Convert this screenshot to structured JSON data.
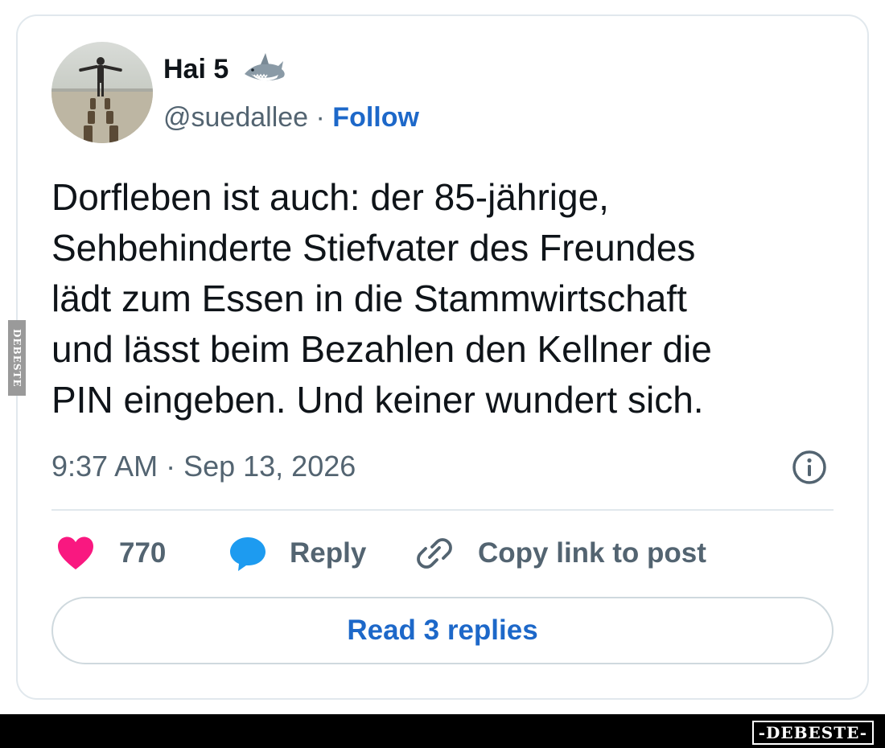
{
  "author": {
    "display_name": "Hai 5",
    "name_emoji": "shark-icon",
    "handle": "@suedallee",
    "separator": " · ",
    "follow_label": "Follow",
    "avatar": "avatar-photo-person-on-groyne"
  },
  "post": {
    "text_lines": [
      "Dorfleben ist auch: der 85-jährige,",
      "Sehbehinderte Stiefvater des Freundes",
      "lädt zum Essen in die Stammwirtschaft",
      "und lässt beim Bezahlen den Kellner die",
      "PIN eingeben. Und keiner wundert sich."
    ],
    "timestamp": "9:37 AM · Sep 13, 2026",
    "info_icon": "info-icon"
  },
  "actions": {
    "like_count": "770",
    "like_icon": "heart-icon",
    "reply_label": "Reply",
    "reply_icon": "speech-bubble-icon",
    "copy_label": "Copy link to post",
    "copy_icon": "link-icon"
  },
  "replies_button": {
    "label": "Read 3 replies"
  },
  "watermark": {
    "side_text": "DEBESTE",
    "footer_text": "-DEBESTE-"
  },
  "colors": {
    "link_blue": "#1d68c9",
    "heart_pink": "#f91880",
    "reply_blue": "#1d9bf0",
    "secondary_text": "#536471",
    "border": "#e1e8ed"
  }
}
